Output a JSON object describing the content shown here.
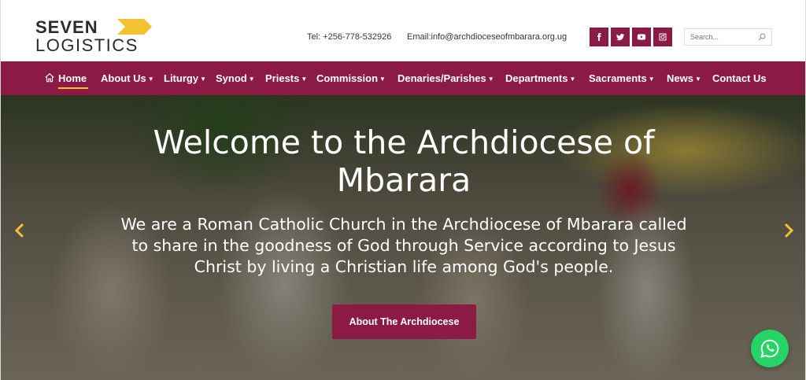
{
  "header": {
    "logo_line1": "SEVEN",
    "logo_line2": "LOGISTICS",
    "tel": "Tel: +256-778-532926",
    "email": "Email:info@archdioceseofmbarara.org.ug",
    "search_placeholder": "Search...",
    "social": [
      "facebook-icon",
      "twitter-icon",
      "youtube-icon",
      "instagram-icon"
    ],
    "colors": {
      "brand": "#8b1a44",
      "accent": "#f2c233",
      "logo_chevron": "#f2c233"
    }
  },
  "nav": {
    "items": [
      {
        "label": "Home",
        "active": true,
        "dropdown": false
      },
      {
        "label": "About Us",
        "dropdown": true
      },
      {
        "label": "Liturgy",
        "dropdown": true
      },
      {
        "label": "Synod",
        "dropdown": true
      },
      {
        "label": "Priests",
        "dropdown": true
      },
      {
        "label": "Commission",
        "dropdown": true
      },
      {
        "label": "Denaries/Parishes",
        "dropdown": true
      },
      {
        "label": "Departments",
        "dropdown": true
      },
      {
        "label": "Sacraments",
        "dropdown": true
      },
      {
        "label": "News",
        "dropdown": true
      },
      {
        "label": "Contact Us",
        "dropdown": false
      }
    ]
  },
  "hero": {
    "title_line1": "Welcome to the Archdiocese of",
    "title_line2": "Mbarara",
    "subtitle_line1": "We are a Roman Catholic Church in the Archdiocese of Mbarara called",
    "subtitle_line2": "to share in the goodness of God through Service according to Jesus",
    "subtitle_line3": "Christ by living a Christian life among God's people.",
    "button_label": "About The Archdiocese",
    "arrow_color": "#f2c233"
  },
  "floating": {
    "whatsapp_color": "#25d366"
  }
}
